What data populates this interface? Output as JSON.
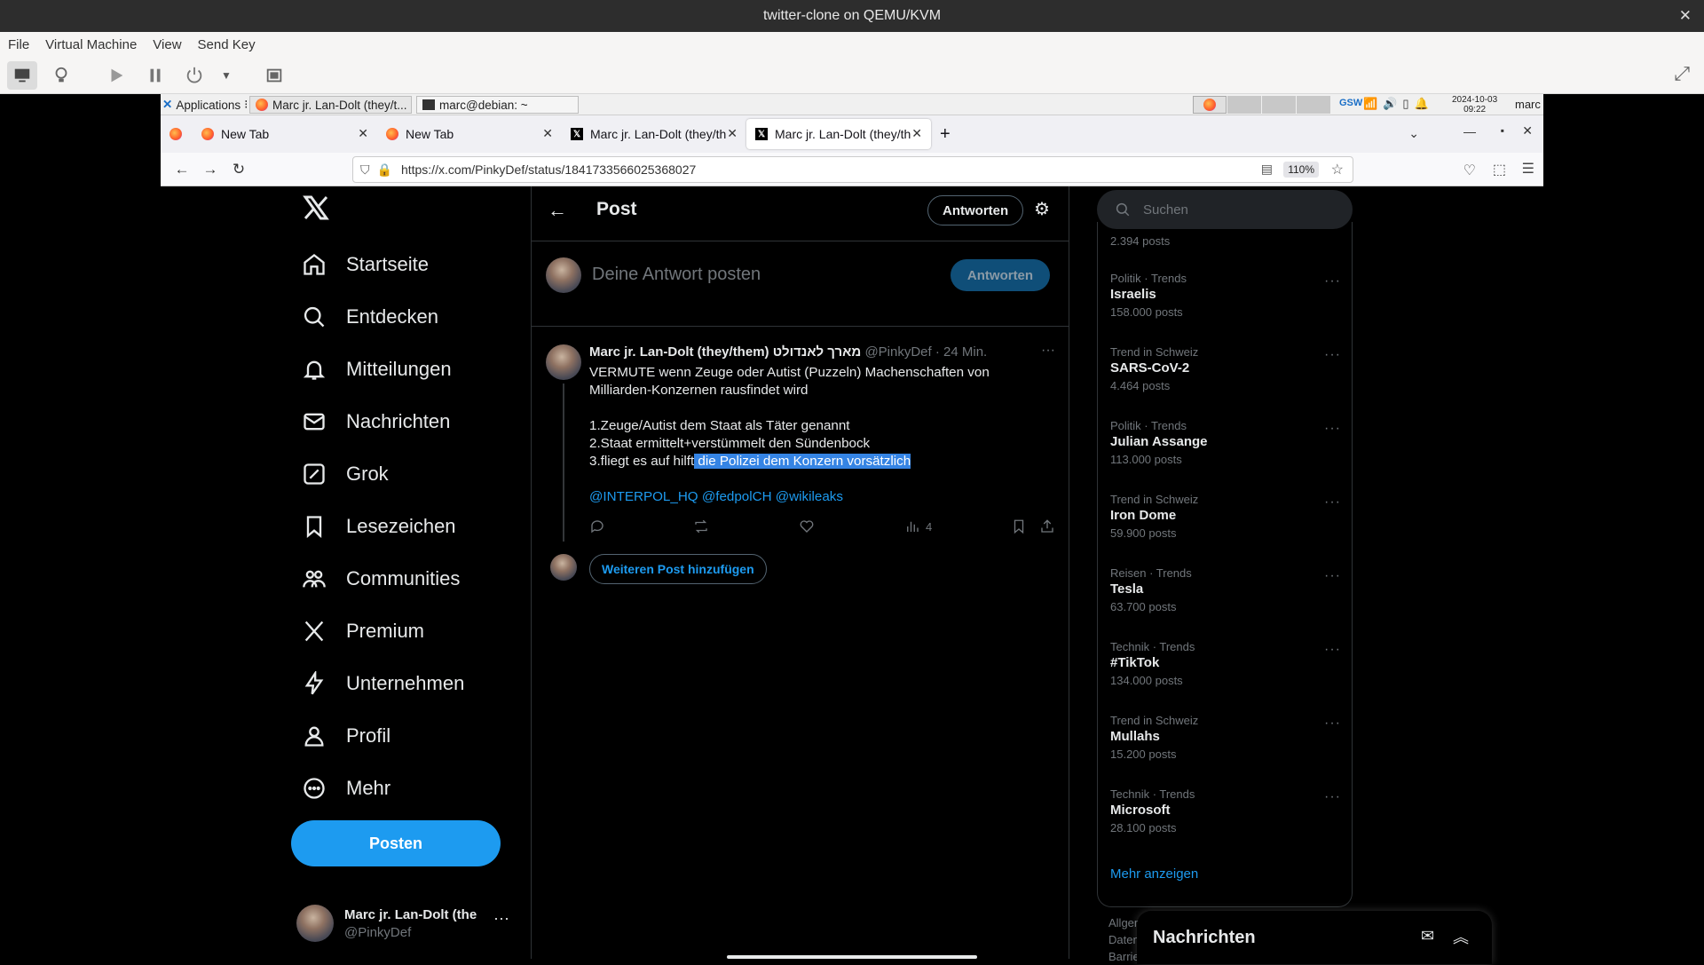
{
  "vm": {
    "title": "twitter-clone on QEMU/KVM",
    "menu": [
      "File",
      "Virtual Machine",
      "View",
      "Send Key"
    ]
  },
  "panel": {
    "apps": "Applications",
    "tasks": [
      "Marc jr. Lan-Dolt (they/t...",
      "marc@debian: ~"
    ],
    "date": "2024-10-03",
    "time": "09:22",
    "user": "marc",
    "kb": "GSW"
  },
  "browser": {
    "tabs": [
      {
        "label": "New Tab"
      },
      {
        "label": "New Tab"
      },
      {
        "label": "Marc jr. Lan-Dolt (they/th"
      },
      {
        "label": "Marc jr. Lan-Dolt (they/th"
      }
    ],
    "url": "https://x.com/PinkyDef/status/1841733566025368027",
    "zoom": "110%"
  },
  "nav": {
    "items": [
      "Startseite",
      "Entdecken",
      "Mitteilungen",
      "Nachrichten",
      "Grok",
      "Lesezeichen",
      "Communities",
      "Premium",
      "Unternehmen",
      "Profil",
      "Mehr"
    ],
    "post_button": "Posten",
    "account_name": "Marc jr. Lan-Dolt (the",
    "account_handle": "@PinkyDef"
  },
  "main": {
    "header_title": "Post",
    "reply_button_header": "Antworten",
    "reply_placeholder": "Deine Antwort posten",
    "reply_button": "Antworten",
    "tweet": {
      "author": "Marc jr. Lan-Dolt (they/them) מארך לאנדולט",
      "handle": "@PinkyDef",
      "time": "· 24 Min.",
      "line1": "VERMUTE wenn Zeuge oder Autist (Puzzeln) Machenschaften von",
      "line2": "Milliarden-Konzernen rausfindet wird",
      "line3": "1.Zeuge/Autist dem Staat als Täter genannt",
      "line4": "2.Staat ermittelt+verstümmelt den Sündenbock",
      "line5_a": "3.fliegt es auf hilft",
      "line5_b": " die Polizei dem Konzern vorsätzlich",
      "mentions": "@INTERPOL_HQ @fedpolCH @wikileaks",
      "views": "4"
    },
    "add_post": "Weiteren Post hinzufügen"
  },
  "sidebar": {
    "search_placeholder": "Suchen",
    "top_count": "2.394 posts",
    "trends": [
      {
        "meta": "Politik · Trends",
        "name": "Israelis",
        "count": "158.000 posts"
      },
      {
        "meta": "Trend in Schweiz",
        "name": "SARS-CoV-2",
        "count": "4.464 posts"
      },
      {
        "meta": "Politik · Trends",
        "name": "Julian Assange",
        "count": "113.000 posts"
      },
      {
        "meta": "Trend in Schweiz",
        "name": "Iron Dome",
        "count": "59.900 posts"
      },
      {
        "meta": "Reisen · Trends",
        "name": "Tesla",
        "count": "63.700 posts"
      },
      {
        "meta": "Technik · Trends",
        "name": "#TikTok",
        "count": "134.000 posts"
      },
      {
        "meta": "Trend in Schweiz",
        "name": "Mullahs",
        "count": "15.200 posts"
      },
      {
        "meta": "Technik · Trends",
        "name": "Microsoft",
        "count": "28.100 posts"
      }
    ],
    "show_more": "Mehr anzeigen",
    "footer1": "Allgemeine",
    "footer2": "Datenschu",
    "footer3": "Barrierefre"
  },
  "messages_drawer": {
    "title": "Nachrichten"
  },
  "colors": {
    "accent": "#1d9bf0",
    "selection": "#3584e4",
    "background": "#000000"
  }
}
